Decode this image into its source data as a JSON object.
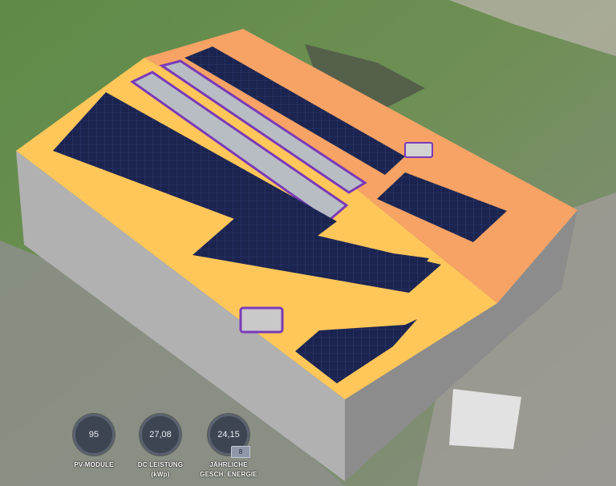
{
  "stats": [
    {
      "value": "95",
      "label": "PV-MODULE",
      "sublabel": ""
    },
    {
      "value": "27,08",
      "label": "DC LEISTUNG",
      "sublabel": "(kWp)"
    },
    {
      "value": "24,15",
      "label": "JÄHRLICHE",
      "sublabel": "GESCH. ENERGIE",
      "badge": "8"
    }
  ],
  "colors": {
    "roof_south": "#ffc75a",
    "roof_north": "#f7a365",
    "panel": "#1b2450",
    "wall": "#a3a3a3",
    "stat_circle": "#3d4452"
  }
}
